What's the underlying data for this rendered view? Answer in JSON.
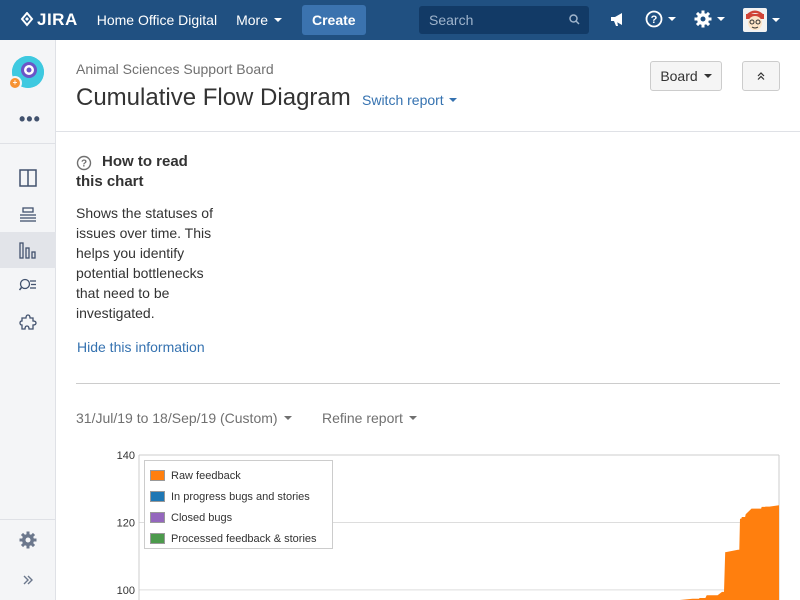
{
  "nav": {
    "logo_text": "JIRA",
    "project": "Home Office Digital",
    "more": "More",
    "create": "Create",
    "search_placeholder": "Search"
  },
  "header": {
    "breadcrumb": "Animal Sciences Support Board",
    "title": "Cumulative Flow Diagram",
    "switch_report": "Switch report",
    "board_button": "Board"
  },
  "info": {
    "title": "How to read this chart",
    "text": "Shows the statuses of issues over time. This helps you identify potential bottlenecks that need to be investigated.",
    "hide_link": "Hide this information"
  },
  "filters": {
    "date_range": "31/Jul/19 to 18/Sep/19 (Custom)",
    "refine": "Refine report"
  },
  "sidebar": {
    "project_badge": "+",
    "items": [
      {
        "name": "board",
        "icon": "board-icon"
      },
      {
        "name": "backlog",
        "icon": "backlog-icon"
      },
      {
        "name": "reports",
        "icon": "reports-icon"
      },
      {
        "name": "issues",
        "icon": "issues-search-icon"
      },
      {
        "name": "add-ons",
        "icon": "puzzle-icon"
      }
    ]
  },
  "chart_data": {
    "type": "area",
    "yticks": [
      100,
      120,
      140
    ],
    "ylim": [
      97,
      140
    ],
    "xlim": [
      0,
      100
    ],
    "legend": [
      {
        "label": "Raw feedback",
        "color": "#ff7f0e"
      },
      {
        "label": "In progress bugs and stories",
        "color": "#1f77b4"
      },
      {
        "label": "Closed bugs",
        "color": "#9467bd"
      },
      {
        "label": "Processed feedback & stories",
        "color": "#4c9a4c"
      }
    ],
    "legend_placement": "top-left",
    "grid": true,
    "series": [
      {
        "name": "Raw feedback",
        "color": "#ff7f0e",
        "x": [
          78.5,
          84.5,
          86.5,
          87.5,
          87.6,
          88,
          88.5,
          88.7,
          90.4,
          91.1,
          91.4,
          91.6,
          91.7,
          92.5,
          93.6,
          93.8,
          93.9,
          94.1,
          94.2,
          94.7,
          94.8,
          95.7,
          96.6,
          97.2,
          97.3,
          97.8,
          97.9,
          98.5,
          100
        ],
        "y": [
          97,
          97,
          97.4,
          97.4,
          97.6,
          97.6,
          97.6,
          98.4,
          98.4,
          99.4,
          99.4,
          111.2,
          111.2,
          111.5,
          111.9,
          111.9,
          121.1,
          121.1,
          121.6,
          121.6,
          122.4,
          124.1,
          124.1,
          124.1,
          124.6,
          124.6,
          124.7,
          124.7,
          125.1
        ]
      }
    ]
  }
}
